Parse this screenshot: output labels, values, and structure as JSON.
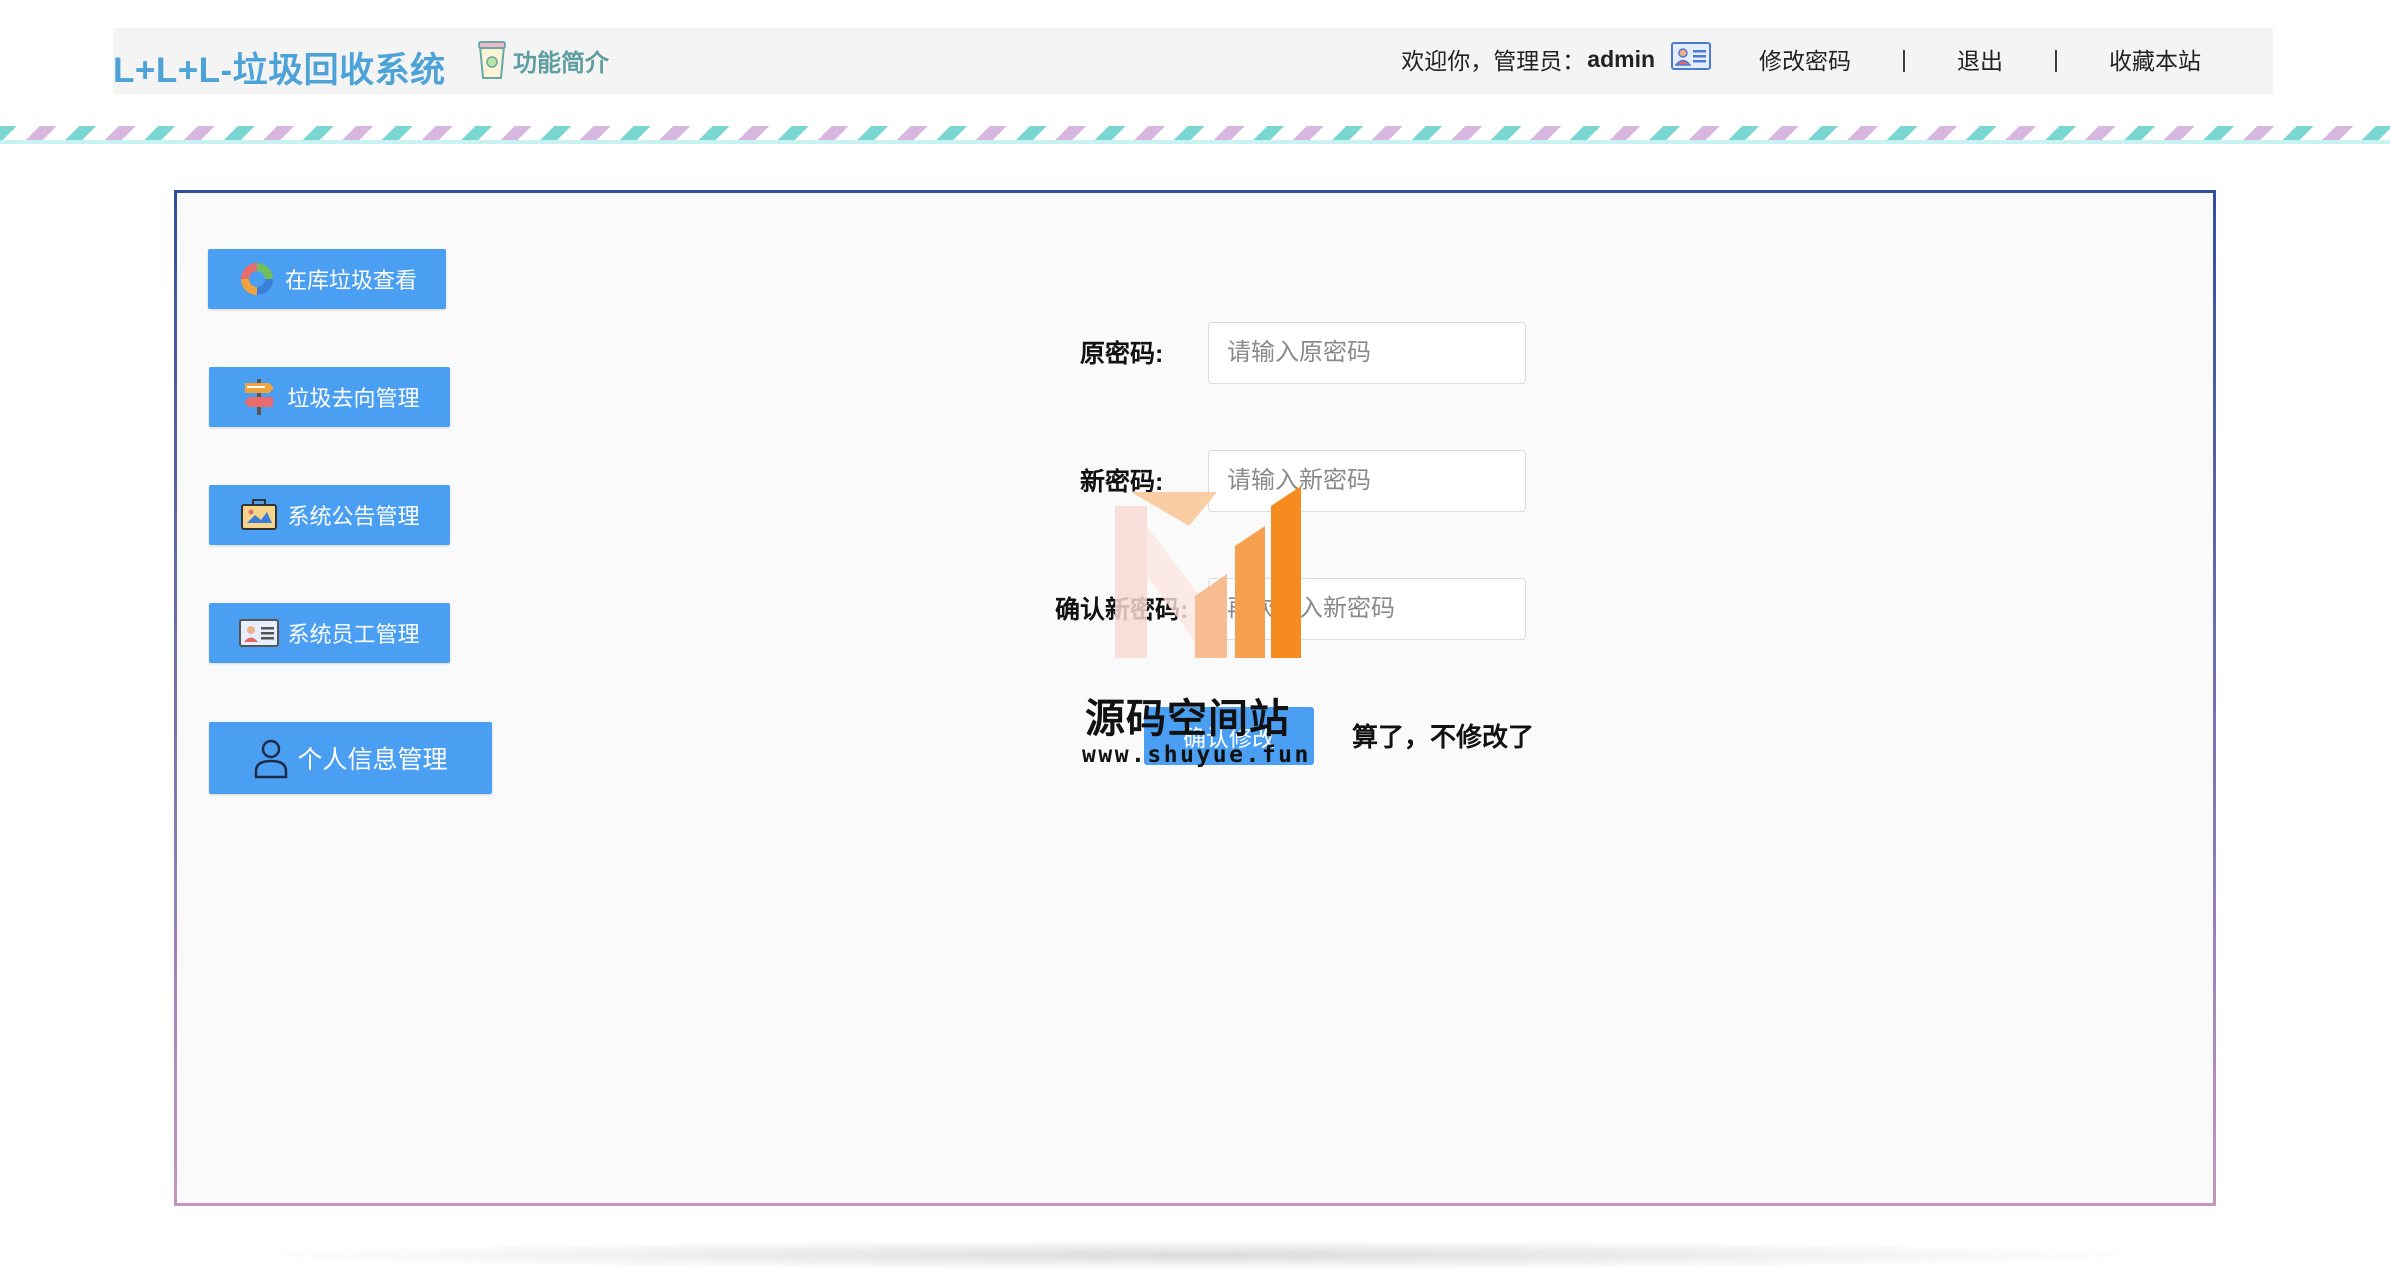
{
  "header": {
    "logo": "L+L+L-垃圾回收系统",
    "intro_label": "功能简介",
    "welcome_prefix": "欢迎你，管理员：",
    "username": "admin",
    "change_password": "修改密码",
    "separator": "|",
    "logout": "退出",
    "bookmark": "收藏本站"
  },
  "sidebar": {
    "items": [
      {
        "label": "在库垃圾查看",
        "icon": "recycle-icon"
      },
      {
        "label": "垃圾去向管理",
        "icon": "signpost-icon"
      },
      {
        "label": "系统公告管理",
        "icon": "announcement-icon"
      },
      {
        "label": "系统员工管理",
        "icon": "id-card-icon"
      },
      {
        "label": "个人信息管理",
        "icon": "user-icon"
      }
    ]
  },
  "form": {
    "old_password_label": "原密码:",
    "old_password_placeholder": "请输入原密码",
    "new_password_label": "新密码:",
    "new_password_placeholder": "请输入新密码",
    "confirm_password_label": "确认新密码:",
    "confirm_password_placeholder": "再次输入新密码",
    "submit_label": "确认修改",
    "cancel_label": "算了，不修改了"
  },
  "watermark": {
    "title": "源码空间站",
    "url": "www.shuyue.fun"
  },
  "colors": {
    "accent": "#4a9ff3",
    "logo": "#4da3d8",
    "intro": "#5f9ea0",
    "watermark_orange": "#f68b1f"
  }
}
